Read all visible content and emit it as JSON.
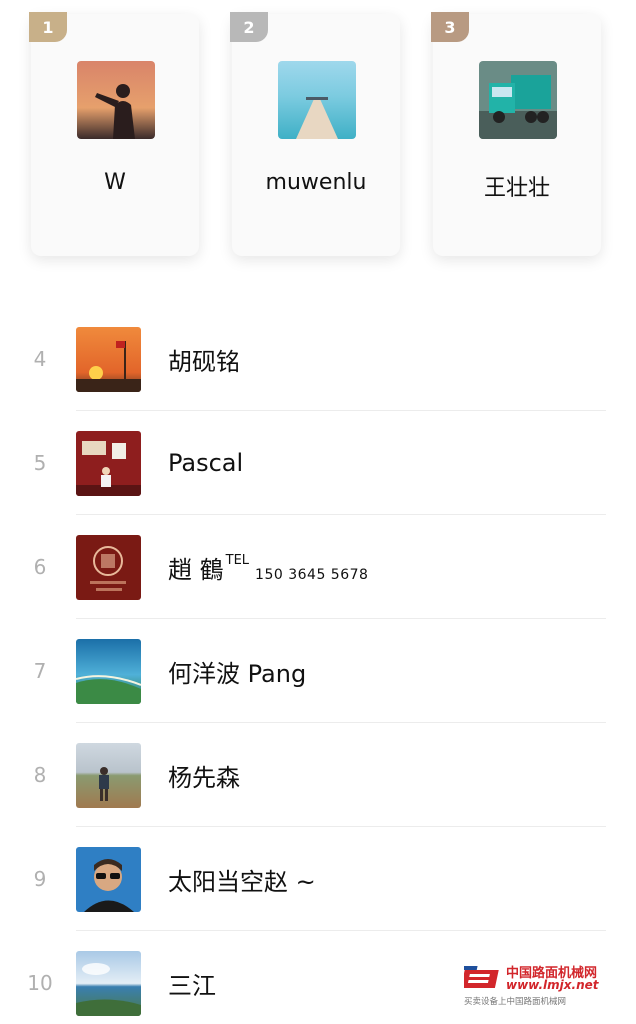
{
  "podium": [
    {
      "rank": "1",
      "name": "W",
      "badge_color": "#c8b089"
    },
    {
      "rank": "2",
      "name": "muwenlu",
      "badge_color": "#b8b8b8"
    },
    {
      "rank": "3",
      "name": "王壮壮",
      "badge_color": "#b89a82"
    }
  ],
  "list": [
    {
      "rank": "4",
      "name": "胡砚铭"
    },
    {
      "rank": "5",
      "name": "Pascal"
    },
    {
      "rank": "6",
      "name": "趙 鶴",
      "tel_label": "TEL",
      "tel_number": "150  3645  5678"
    },
    {
      "rank": "7",
      "name": "何洋波 Pang"
    },
    {
      "rank": "8",
      "name": "杨先森"
    },
    {
      "rank": "9",
      "name": "太阳当空赵 ~"
    },
    {
      "rank": "10",
      "name": "三江"
    }
  ],
  "watermark": {
    "title": "中国路面机械网",
    "url": "www.lmjx.net",
    "subtitle": "买卖设备上中国路面机械网"
  },
  "avatar_icons": [
    "silhouette-sunset-photo",
    "sea-pier-photo",
    "green-truck-photo",
    "sunset-flag-photo",
    "red-wall-person-photo",
    "zhao-seal-logo",
    "coast-aerial-photo",
    "field-walker-photo",
    "sunglasses-man-photo",
    "sky-sea-photo"
  ]
}
